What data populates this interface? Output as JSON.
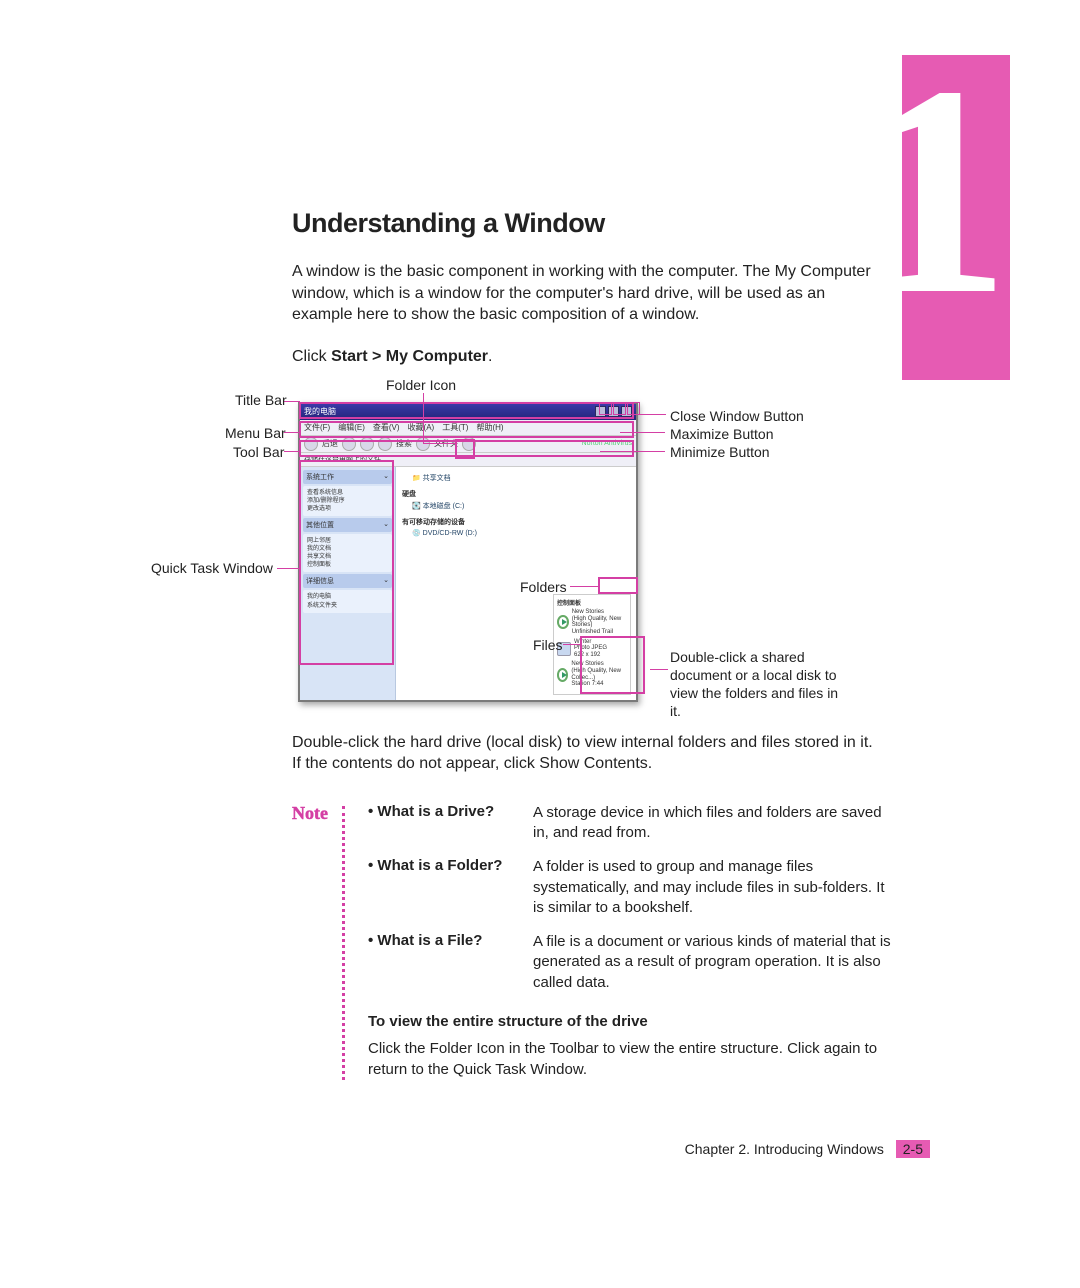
{
  "chapter_tab_number": "1",
  "heading": "Understanding a Window",
  "intro": "A window is the basic component in working with the computer. The My Computer window, which is a window for the computer's hard drive, will be used as an example here to show the basic composition of a window.",
  "click_line_prefix": "Click ",
  "click_line_bold": "Start > My Computer",
  "click_line_suffix": ".",
  "callouts": {
    "title_bar": "Title Bar",
    "menu_bar": "Menu Bar",
    "tool_bar": "Tool Bar",
    "quick_task_window": "Quick Task Window",
    "folder_icon": "Folder Icon",
    "folders": "Folders",
    "files": "Files",
    "close_button": "Close Window Button",
    "maximize_button": "Maximize Button",
    "minimize_button": "Minimize Button",
    "shared_tip": "Double-click a shared document or a local disk to view the folders and files in it."
  },
  "window_mock": {
    "title_caption": "我的电脑",
    "menus": [
      "文件(F)",
      "编辑(E)",
      "查看(V)",
      "收藏(A)",
      "工具(T)",
      "帮助(H)"
    ],
    "toolbar_labels": [
      "后退",
      "·",
      "搜索",
      "文件夹"
    ],
    "toolbar_right": "Norton AntiVirus",
    "address_label": "存储在这台电脑上的文件",
    "side_sections": [
      {
        "header": "系统工作",
        "items": [
          "查看系统信息",
          "添加/删除程序",
          "更改选项"
        ]
      },
      {
        "header": "其他位置",
        "items": [
          "网上邻居",
          "我的文档",
          "共享文档",
          "控制面板"
        ]
      },
      {
        "header": "详细信息",
        "items": []
      }
    ],
    "side_footer": "我的电脑\n系统文件夹",
    "main_groups": [
      {
        "label": "共享文档",
        "icon": "folder"
      },
      {
        "label": "硬盘",
        "items": [
          "本地磁盘 (C:)"
        ]
      },
      {
        "label": "有可移动存储的设备",
        "items": [
          "DVD/CD-RW (D:)"
        ]
      }
    ],
    "detail_title": "控制面板",
    "detail_rows": [
      {
        "icon": "play",
        "lines": [
          "New Stories",
          "(High Quality, New Stories)",
          "Unfinished Trail"
        ]
      },
      {
        "icon": "doc",
        "lines": [
          "Winter",
          "Photo JPEG",
          "622 x 192"
        ]
      },
      {
        "icon": "play",
        "lines": [
          "New Stories",
          "(High Quality, New Collec...)",
          "Station 7:44"
        ]
      }
    ]
  },
  "after_paragraph": "Double-click the hard drive (local disk) to view internal folders and files stored in it. If the contents do not appear, click Show Contents.",
  "note_label": "Note",
  "definitions": [
    {
      "term": "What is a Drive?",
      "desc": "A storage device in which files and folders are saved in,  and read from."
    },
    {
      "term": "What is a Folder?",
      "desc": "A folder is used to group and manage files systematically, and may include files in sub-folders. It is similar to a bookshelf."
    },
    {
      "term": "What is a File?",
      "desc": "A file is a document or various kinds of material that is generated as a result of program operation. It is also called data."
    }
  ],
  "note_subhead": "To view the entire structure of the drive",
  "note_paragraph": "Click the Folder Icon in the Toolbar to view the entire structure. Click again to return to the Quick Task Window.",
  "footer_chapter": "Chapter 2. Introducing Windows",
  "footer_page": "2-5"
}
